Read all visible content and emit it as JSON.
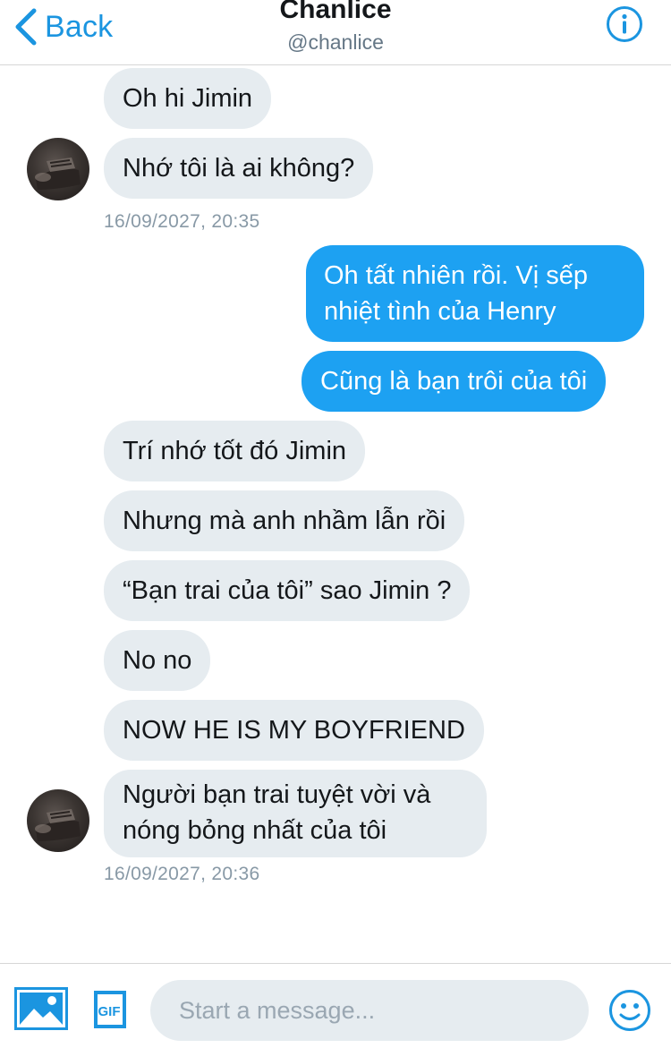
{
  "header": {
    "back_label": "Back",
    "title": "Chanlice",
    "handle": "@chanlice"
  },
  "conversation": {
    "messages": [
      {
        "side": "received",
        "text": "Oh hi Jimin"
      },
      {
        "side": "received",
        "text": "Nhớ tôi là ai không?"
      },
      {
        "side": "sent",
        "text": "Oh tất nhiên rồi. Vị sếp nhiệt tình của Henry"
      },
      {
        "side": "sent",
        "text": "Cũng là bạn trôi của tôi"
      },
      {
        "side": "received",
        "text": "Trí nhớ tốt đó Jimin"
      },
      {
        "side": "received",
        "text": "Nhưng mà anh nhầm lẫn rồi"
      },
      {
        "side": "received",
        "text": "“Bạn trai của tôi” sao Jimin ?"
      },
      {
        "side": "received",
        "text": "No no"
      },
      {
        "side": "received",
        "text": "NOW HE IS MY BOYFRIEND"
      },
      {
        "side": "received",
        "text": "Người bạn trai tuyệt vời và nóng bỏng nhất của tôi"
      }
    ],
    "timestamps": [
      "16/09/2027, 20:35",
      "16/09/2027, 20:36"
    ]
  },
  "composer": {
    "placeholder": "Start a message...",
    "gif_label": "GIF"
  },
  "icons": {
    "back": "chevron-left-icon",
    "info": "info-icon",
    "media": "image-icon",
    "gif": "gif-icon",
    "emoji": "smiley-icon"
  },
  "colors": {
    "accent": "#1da1f2",
    "link": "#1b95e0",
    "received_bubble": "#e6ecf0",
    "timestamp": "#8899a6"
  }
}
